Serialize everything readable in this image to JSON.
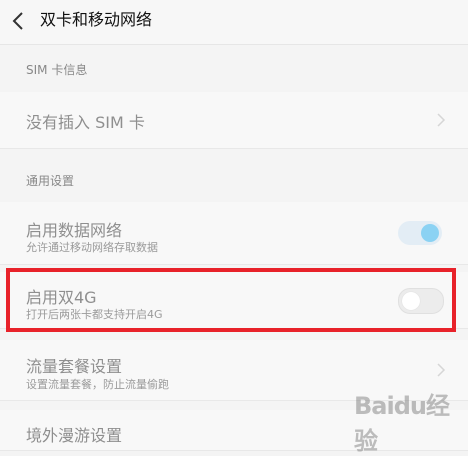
{
  "header": {
    "title": "双卡和移动网络"
  },
  "sim_section": {
    "label": "SIM 卡信息",
    "status_row": {
      "title": "没有插入 SIM 卡"
    }
  },
  "general_section": {
    "label": "通用设置",
    "data_network": {
      "title": "启用数据网络",
      "subtitle": "允许通过移动网络存取数据",
      "enabled": true
    },
    "dual_4g": {
      "title": "启用双4G",
      "subtitle": "打开后两张卡都支持开启4G",
      "enabled": false
    },
    "data_plan": {
      "title": "流量套餐设置",
      "subtitle": "设置流量套餐，防止流量偷跑"
    },
    "roaming": {
      "title": "境外漫游设置"
    }
  },
  "watermark": {
    "text": "Baidu经验"
  },
  "colors": {
    "highlight": "#e8222a",
    "toggle_on": "#8bd2f3"
  }
}
